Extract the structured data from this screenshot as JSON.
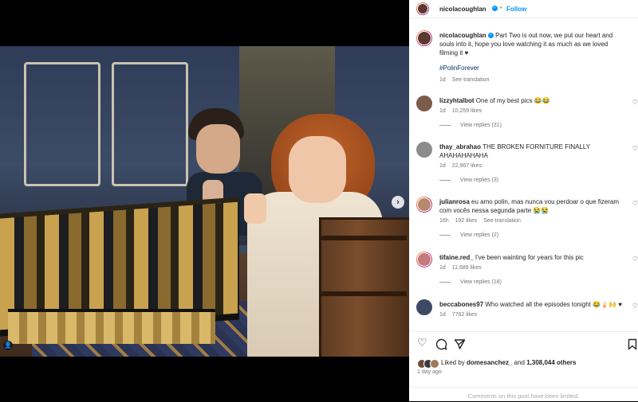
{
  "header": {
    "username": "nicolacoughlan",
    "dot": "•",
    "follow_label": "Follow",
    "more": "···"
  },
  "caption": {
    "username": "nicolacoughlan",
    "text": "Part Two is out now, we put our heart and souls into it, hope you love watching it as much as we loved filming it ♥",
    "hashtag": "#PolinForever",
    "time": "1d",
    "see_translation": "See translation"
  },
  "comments": [
    {
      "username": "lizzyhtalbot",
      "text": "One of my best pics 😂😂",
      "time": "1d",
      "likes": "10,259 likes",
      "reply": "",
      "view_replies": "View replies (31)"
    },
    {
      "username": "thay_abrahao",
      "text": "THE BROKEN FORNITURE FINALLY AHAHAHAHAHA",
      "time": "1d",
      "likes": "22,967 likes",
      "reply": "",
      "view_replies": "View replies (3)"
    },
    {
      "username": "julianrosa",
      "text": "eu amo polin, mas nunca vou perdoar o que fizeram com vocês nessa segunda parte 😭😭",
      "time": "16h",
      "likes": "192 likes",
      "reply": "See translation",
      "view_replies": "View replies (2)"
    },
    {
      "username": "tifaine.red_",
      "text": "I've been wainting for years for this pic",
      "time": "1d",
      "likes": "11,689 likes",
      "reply": "",
      "view_replies": "View replies (18)"
    },
    {
      "username": "beccabones97",
      "text": "Who watched all the episodes tonight 😂🍦🙌 ♥",
      "time": "1d",
      "likes": "7762 likes",
      "reply": "",
      "view_replies": ""
    }
  ],
  "actions": {
    "liked_by_prefix": "Liked by",
    "liked_by_user": "domesanchez_",
    "liked_by_and": "and",
    "liked_by_count": "1,308,044 others",
    "time": "1 day ago",
    "limited": "Comments on this post have been limited."
  },
  "media": {
    "next_arrow": "›",
    "user_tag": "👤"
  }
}
